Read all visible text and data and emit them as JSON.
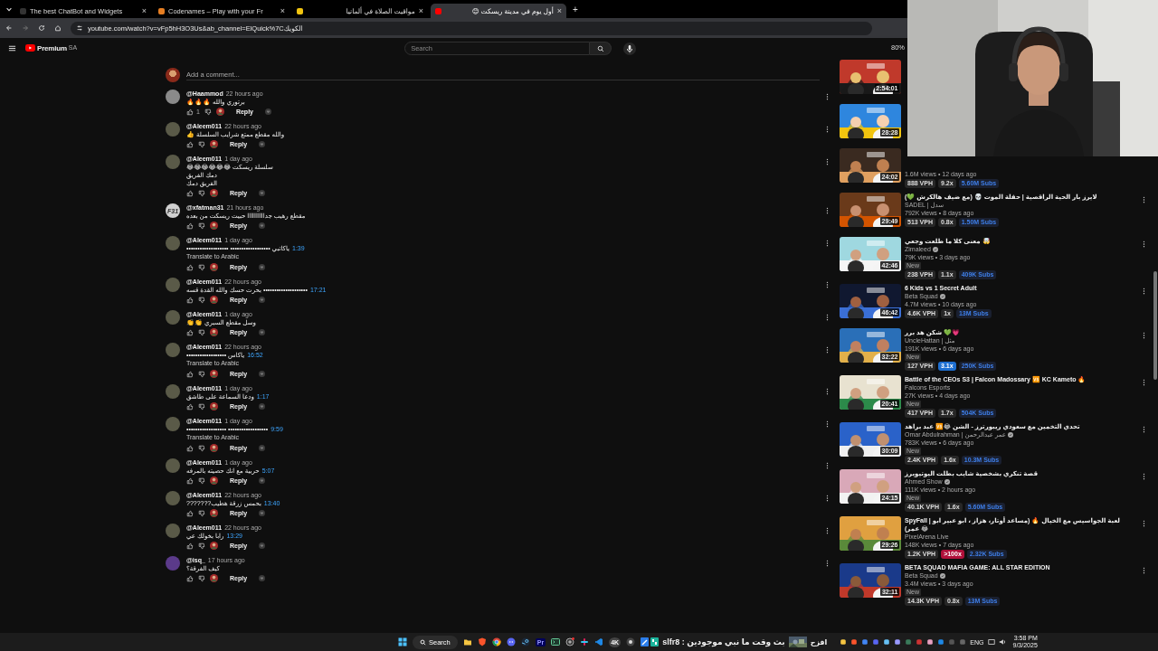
{
  "browser": {
    "tabs": [
      {
        "title": "The best ChatBot and Widgets",
        "close": "×",
        "selected": false
      },
      {
        "title": "Codenames – Play with your Fr",
        "close": "×",
        "selected": false
      },
      {
        "title": "مواقيت الصلاة في ألمانيا",
        "close": "×",
        "selected": false
      },
      {
        "title": "أول يوم في مدينة ريسكت 😊",
        "close": "×",
        "selected": true
      }
    ],
    "new_tab": "+",
    "url": "youtube.com/watch?v=vFp5hH3O3Us&ab_channel=ElQuick%7Cالكويك",
    "zoom": "80%"
  },
  "header": {
    "logo": "Premium",
    "region": "SA",
    "search": {
      "placeholder": "Search"
    }
  },
  "add_comment": {
    "placeholder": "Add a comment..."
  },
  "comments": [
    {
      "author": "@Haammod",
      "time": "22 hours ago",
      "color": "#8a8a8a",
      "lines": [
        "برتوري والله 🔥🔥🔥"
      ],
      "likes": "1",
      "reply": "Reply"
    },
    {
      "author": "@Aleem011",
      "time": "22 hours ago",
      "color": "#5a5a48",
      "lines": [
        "والله مقطع ممتع شرايب السلسلة 👍"
      ],
      "reply": "Reply"
    },
    {
      "author": "@Aleem011",
      "time": "1 day ago",
      "color": "#5a5a48",
      "lines": [
        "سلسلة ريسكت 😂😂😂😂😂😂",
        "دمك الفريق",
        "الفريق دمك"
      ],
      "reply": "Reply"
    },
    {
      "author": "@xfatman31",
      "time": "21 hours ago",
      "color": "#d0d0d0",
      "initials": "F31",
      "lines": [
        "مقطع رهيب جداااااااااا حبيت ريسكت من بعده"
      ],
      "reply": "Reply"
    },
    {
      "author": "@Aleem011",
      "time": "1 day ago",
      "color": "#5a5a48",
      "lines": [
        "ياكاتبي •••••••••••••••••• •••••••••••••••••••"
      ],
      "timestamp": "1:39",
      "translate": "Translate to Arabic",
      "reply": "Reply"
    },
    {
      "author": "@Aleem011",
      "time": "22 hours ago",
      "color": "#5a5a48",
      "lines": [
        "•••••••••••••••••••• بحرت حسك والله القدة قسه"
      ],
      "timestamp": "17:21",
      "reply": "Reply"
    },
    {
      "author": "@Aleem011",
      "time": "1 day ago",
      "color": "#5a5a48",
      "lines": [
        "وسل مقطع السبري 👏👏"
      ],
      "reply": "Reply"
    },
    {
      "author": "@Aleem011",
      "time": "22 hours ago",
      "color": "#5a5a48",
      "lines": [
        "ياكاس ••••••••••••••••••"
      ],
      "timestamp": "16:52",
      "translate": "Translate to Arabic",
      "reply": "Reply"
    },
    {
      "author": "@Aleem011",
      "time": "1 day ago",
      "color": "#5a5a48",
      "lines": [
        "ودعا السماعة على طاشق"
      ],
      "timestamp": "1:17",
      "reply": "Reply"
    },
    {
      "author": "@Aleem011",
      "time": "1 day ago",
      "color": "#5a5a48",
      "lines": [
        "•••••••••••••••••• ••••••••••••••••••"
      ],
      "timestamp": "9:59",
      "translate": "Translate to Arabic",
      "reply": "Reply"
    },
    {
      "author": "@Aleem011",
      "time": "1 day ago",
      "color": "#5a5a48",
      "lines": [
        "حربية مع انك حصيته بالمرفه"
      ],
      "timestamp": "5:07",
      "reply": "Reply"
    },
    {
      "author": "@Aleem011",
      "time": "22 hours ago",
      "color": "#5a5a48",
      "lines": [
        "بحمس زرقة هطيب???????"
      ],
      "timestamp": "13:40",
      "reply": "Reply"
    },
    {
      "author": "@Aleem011",
      "time": "22 hours ago",
      "color": "#5a5a48",
      "lines": [
        "رابا بخولك عي"
      ],
      "timestamp": "13:29",
      "reply": "Reply"
    },
    {
      "author": "@isq_",
      "time": "17 hours ago",
      "color": "#5b3a8a",
      "lines": [
        "كيف الفرقة؟"
      ],
      "reply": "Reply"
    }
  ],
  "videos": [
    {
      "duration": "2:54:01",
      "menu": false
    },
    {
      "duration": "28:28",
      "menu": false
    },
    {
      "duration": "24:02",
      "menu": false,
      "meta": "1.6M views • 12 days ago",
      "stats": [
        {
          "text": "888 VPH",
          "kind": "plain"
        },
        {
          "text": "9.2x",
          "kind": "plain"
        },
        {
          "text": "5.60M Subs",
          "kind": "subs"
        }
      ]
    },
    {
      "duration": "29:49",
      "menu": true,
      "title": "لايرز بار الحية الراقصية | حفلة الموت 💀 (مع ضيف هالكرش 💚)",
      "channel": "SADEL | سدل",
      "verified": false,
      "meta": "792K views • 8 days ago",
      "stats": [
        {
          "text": "513 VPH",
          "kind": "plain"
        },
        {
          "text": "0.8x",
          "kind": "plain"
        },
        {
          "text": "1.50M Subs",
          "kind": "subs"
        }
      ]
    },
    {
      "duration": "42:46",
      "menu": true,
      "title": "🤯 معنى كلا ما طلعت وجعي",
      "channel": "Zimaleed",
      "verified": true,
      "meta": "79K views • 3 days ago",
      "new": "New",
      "stats": [
        {
          "text": "238 VPH",
          "kind": "plain"
        },
        {
          "text": "1.1x",
          "kind": "plain"
        },
        {
          "text": "409K Subs",
          "kind": "subs"
        }
      ]
    },
    {
      "duration": "46:42",
      "menu": true,
      "title": "6 Kids vs 1 Secret Adult",
      "channel": "Beta Squad",
      "verified": true,
      "meta": "4.7M views • 10 days ago",
      "stats": [
        {
          "text": "4.6K VPH",
          "kind": "plain"
        },
        {
          "text": "1x",
          "kind": "plain"
        },
        {
          "text": "13M Subs",
          "kind": "subs"
        }
      ]
    },
    {
      "duration": "32:22",
      "menu": true,
      "title": "💗💚 شكن هد برر",
      "channel": "UncleHattan | مثل",
      "verified": false,
      "meta": "191K views • 6 days ago",
      "new": "New",
      "stats": [
        {
          "text": "127 VPH",
          "kind": "plain"
        },
        {
          "text": "3.1x",
          "kind": "hot"
        },
        {
          "text": "250K Subs",
          "kind": "subs"
        }
      ]
    },
    {
      "duration": "20:41",
      "menu": true,
      "title": "Battle of the CEOs S3 | Falcon Madossary 🆚 KC Kameto 🔥",
      "channel": "Falcons Esports",
      "verified": false,
      "meta": "27K views • 4 days ago",
      "new": "New",
      "stats": [
        {
          "text": "417 VPH",
          "kind": "plain"
        },
        {
          "text": "1.7x",
          "kind": "plain"
        },
        {
          "text": "504K Subs",
          "kind": "subs"
        }
      ]
    },
    {
      "duration": "30:09",
      "menu": true,
      "title": "تحدي التخمين مع سعودي ريبورترز - الشن 😂🆚 عبد براهد",
      "channel": "Omar Abdulrahman | عمر عبدالرحمن",
      "verified": true,
      "meta": "783K views • 6 days ago",
      "new": "New",
      "stats": [
        {
          "text": "2.4K VPH",
          "kind": "plain"
        },
        {
          "text": "1.6x",
          "kind": "plain"
        },
        {
          "text": "10.3M Subs",
          "kind": "subs"
        }
      ]
    },
    {
      "duration": "24:15",
      "menu": true,
      "title": "قصة تنكري بشخصية شايب بطلت اليوتيوبرز",
      "channel": "Ahmed Show",
      "verified": true,
      "meta": "111K views • 2 hours ago",
      "new": "New",
      "stats": [
        {
          "text": "40.1K VPH",
          "kind": "plain"
        },
        {
          "text": "1.6x",
          "kind": "plain"
        },
        {
          "text": "5.60M Subs",
          "kind": "subs"
        }
      ]
    },
    {
      "duration": "29:26",
      "menu": true,
      "title": "SpyFall | لعبة الجواسيس مع الخيال 🔥 (مساعد أوتار، هزاز ، ابو عبير ابو عمر) 😂",
      "channel": "PixelArena Live",
      "verified": false,
      "meta": "148K views • 7 days ago",
      "stats": [
        {
          "text": "1.2K VPH",
          "kind": "plain"
        },
        {
          "text": ">100x",
          "kind": "fire"
        },
        {
          "text": "2.32K Subs",
          "kind": "subs"
        }
      ]
    },
    {
      "duration": "32:11",
      "menu": true,
      "title": "BETA SQUAD MAFIA GAME: ALL STAR EDITION",
      "channel": "Beta Squad",
      "verified": true,
      "meta": "3.4M views • 3 days ago",
      "new": "New",
      "stats": [
        {
          "text": "14.3K VPH",
          "kind": "plain"
        },
        {
          "text": "0.8x",
          "kind": "plain"
        },
        {
          "text": "13M Subs",
          "kind": "subs"
        }
      ]
    }
  ],
  "taskbar": {
    "search": "Search",
    "premiere": "Pr",
    "downloader": "4K",
    "media_title": "بث وقت ما نبي موجودين : slfr8",
    "media_label": "افزح",
    "language": "ENG",
    "time": "3:58 PM",
    "date": "9/3/2025"
  }
}
